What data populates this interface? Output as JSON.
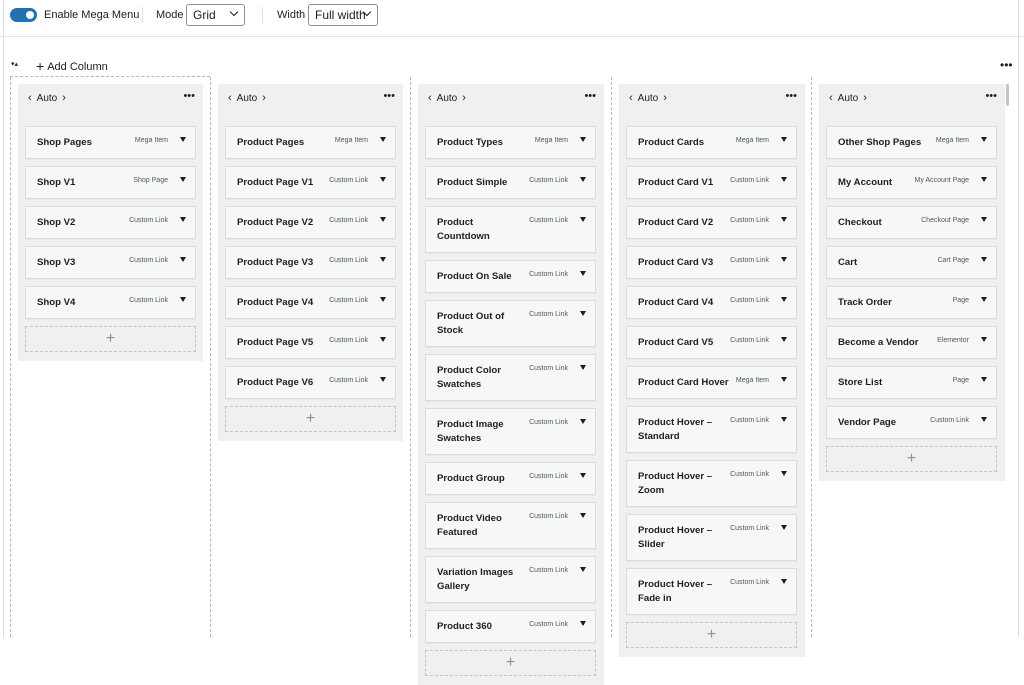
{
  "toolbar": {
    "enable_label": "Enable Mega Menu",
    "mode_label": "Mode",
    "mode_value": "Grid",
    "width_label": "Width",
    "width_value": "Full width"
  },
  "add_column_label": "Add Column",
  "columns": [
    {
      "width_label": "Auto",
      "items": [
        {
          "title": "Shop Pages",
          "type": "Mega Item"
        },
        {
          "title": "Shop V1",
          "type": "Shop Page"
        },
        {
          "title": "Shop V2",
          "type": "Custom Link"
        },
        {
          "title": "Shop V3",
          "type": "Custom Link"
        },
        {
          "title": "Shop V4",
          "type": "Custom Link"
        }
      ]
    },
    {
      "width_label": "Auto",
      "items": [
        {
          "title": "Product Pages",
          "type": "Mega Item"
        },
        {
          "title": "Product Page V1",
          "type": "Custom Link"
        },
        {
          "title": "Product Page V2",
          "type": "Custom Link"
        },
        {
          "title": "Product Page V3",
          "type": "Custom Link"
        },
        {
          "title": "Product Page V4",
          "type": "Custom Link"
        },
        {
          "title": "Product Page V5",
          "type": "Custom Link"
        },
        {
          "title": "Product Page V6",
          "type": "Custom Link"
        }
      ]
    },
    {
      "width_label": "Auto",
      "items": [
        {
          "title": "Product Types",
          "type": "Mega Item"
        },
        {
          "title": "Product Simple",
          "type": "Custom Link"
        },
        {
          "title": "Product Countdown",
          "type": "Custom Link"
        },
        {
          "title": "Product On Sale",
          "type": "Custom Link"
        },
        {
          "title": "Product Out of Stock",
          "type": "Custom Link"
        },
        {
          "title": "Product Color Swatches",
          "type": "Custom Link"
        },
        {
          "title": "Product Image Swatches",
          "type": "Custom Link"
        },
        {
          "title": "Product Group",
          "type": "Custom Link"
        },
        {
          "title": "Product Video Featured",
          "type": "Custom Link"
        },
        {
          "title": "Variation Images Gallery",
          "type": "Custom Link"
        },
        {
          "title": "Product 360",
          "type": "Custom Link"
        }
      ]
    },
    {
      "width_label": "Auto",
      "items": [
        {
          "title": "Product Cards",
          "type": "Mega Item"
        },
        {
          "title": "Product Card V1",
          "type": "Custom Link"
        },
        {
          "title": "Product Card V2",
          "type": "Custom Link"
        },
        {
          "title": "Product Card V3",
          "type": "Custom Link"
        },
        {
          "title": "Product Card V4",
          "type": "Custom Link"
        },
        {
          "title": "Product Card V5",
          "type": "Custom Link"
        },
        {
          "title": "Product Card Hover",
          "type": "Mega Item"
        },
        {
          "title": "Product Hover – Standard",
          "type": "Custom Link"
        },
        {
          "title": "Product Hover – Zoom",
          "type": "Custom Link"
        },
        {
          "title": "Product Hover – Slider",
          "type": "Custom Link"
        },
        {
          "title": "Product Hover – Fade in",
          "type": "Custom Link"
        }
      ]
    },
    {
      "width_label": "Auto",
      "items": [
        {
          "title": "Other Shop Pages",
          "type": "Mega Item"
        },
        {
          "title": "My Account",
          "type": "My Account Page"
        },
        {
          "title": "Checkout",
          "type": "Checkout Page"
        },
        {
          "title": "Cart",
          "type": "Cart Page"
        },
        {
          "title": "Track Order",
          "type": "Page"
        },
        {
          "title": "Become a Vendor",
          "type": "Elementor"
        },
        {
          "title": "Store List",
          "type": "Page"
        },
        {
          "title": "Vendor Page",
          "type": "Custom Link"
        }
      ]
    }
  ],
  "icons": {
    "more": "more-horizontal-icon",
    "collapse": "collapse-icon",
    "add": "plus-icon",
    "dropdown": "caret-down-icon"
  },
  "colors": {
    "toggle_on": "#2271b1",
    "column_bg": "#f0f0f1",
    "item_bg": "#f6f7f7"
  }
}
